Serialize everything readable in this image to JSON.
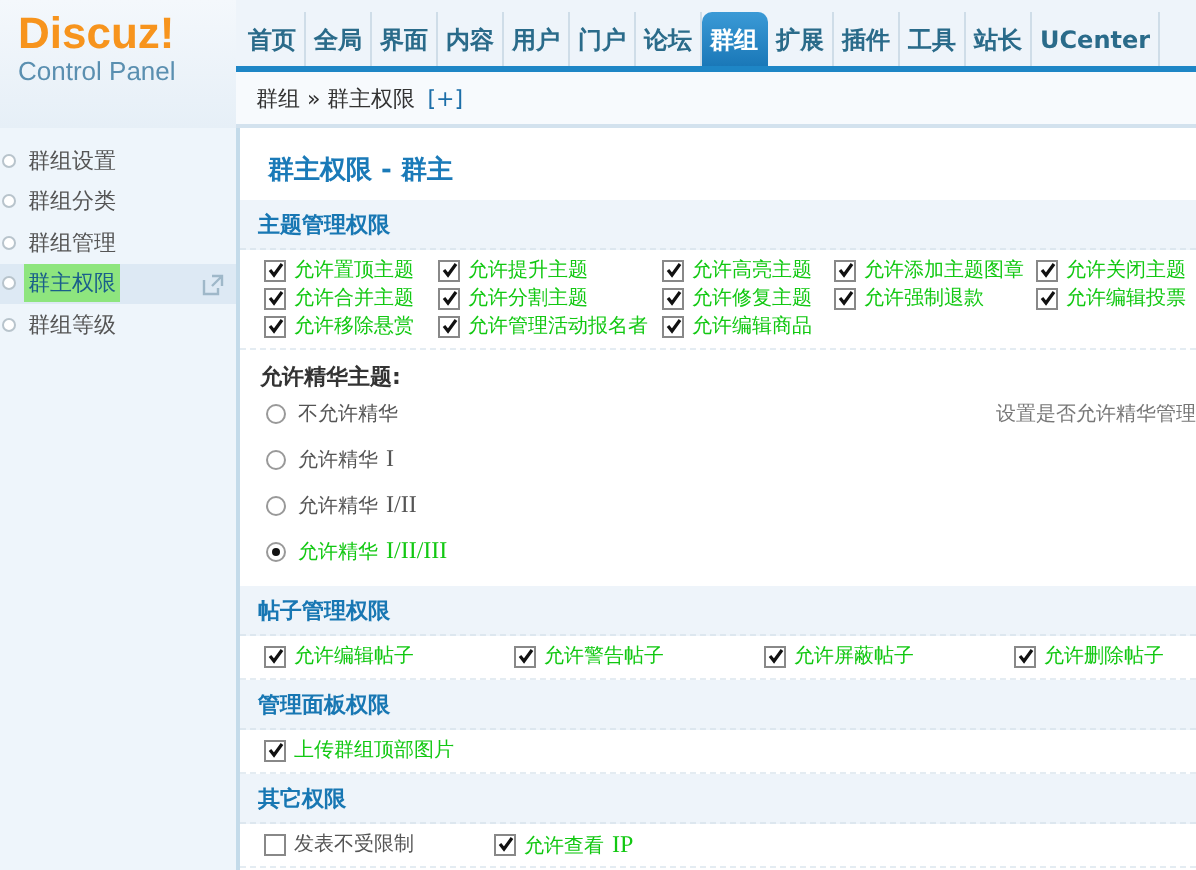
{
  "logo": {
    "brand": "Discuz!",
    "subtitle": "Control Panel"
  },
  "nav": [
    {
      "label": "首页",
      "selected": false
    },
    {
      "label": "全局",
      "selected": false
    },
    {
      "label": "界面",
      "selected": false
    },
    {
      "label": "内容",
      "selected": false
    },
    {
      "label": "用户",
      "selected": false
    },
    {
      "label": "门户",
      "selected": false
    },
    {
      "label": "论坛",
      "selected": false
    },
    {
      "label": "群组",
      "selected": true
    },
    {
      "label": "扩展",
      "selected": false
    },
    {
      "label": "插件",
      "selected": false
    },
    {
      "label": "工具",
      "selected": false
    },
    {
      "label": "站长",
      "selected": false
    },
    {
      "label": "UCenter",
      "selected": false
    }
  ],
  "breadcrumb": {
    "path": "群组 » 群主权限",
    "add_link": "[+]"
  },
  "sidebar": {
    "items": [
      {
        "label": "群组设置",
        "selected": false
      },
      {
        "label": "群组分类",
        "selected": false
      },
      {
        "label": "群组管理",
        "selected": false
      },
      {
        "label": "群主权限",
        "selected": true
      },
      {
        "label": "群组等级",
        "selected": false
      }
    ]
  },
  "page_title": "群主权限 - 群主",
  "sections": [
    {
      "kind": "checkboxes",
      "title": "主题管理权限",
      "options": [
        {
          "label": "允许置顶主题",
          "checked": true
        },
        {
          "label": "允许提升主题",
          "checked": true
        },
        {
          "label": "允许高亮主题",
          "checked": true
        },
        {
          "label": "允许添加主题图章",
          "checked": true
        },
        {
          "label": "允许关闭主题",
          "checked": true
        },
        {
          "label": "允许合并主题",
          "checked": true
        },
        {
          "label": "允许分割主题",
          "checked": true
        },
        {
          "label": "允许修复主题",
          "checked": true
        },
        {
          "label": "允许强制退款",
          "checked": true
        },
        {
          "label": "允许编辑投票",
          "checked": true
        },
        {
          "label": "允许移除悬赏",
          "checked": true
        },
        {
          "label": "允许管理活动报名者",
          "checked": true
        },
        {
          "label": "允许编辑商品",
          "checked": true
        }
      ]
    },
    {
      "kind": "radios",
      "title": "允许精华主题:",
      "note": "设置是否允许精华管理",
      "options": [
        {
          "label": "不允许精华",
          "selected": false
        },
        {
          "label": "允许精华",
          "suffix": "I",
          "selected": false
        },
        {
          "label": "允许精华",
          "suffix": "I/II",
          "selected": false
        },
        {
          "label": "允许精华",
          "suffix": "I/II/III",
          "selected": true
        }
      ]
    },
    {
      "kind": "checkboxes",
      "title": "帖子管理权限",
      "options": [
        {
          "label": "允许编辑帖子",
          "checked": true
        },
        {
          "label": "允许警告帖子",
          "checked": true
        },
        {
          "label": "允许屏蔽帖子",
          "checked": true
        },
        {
          "label": "允许删除帖子",
          "checked": true
        }
      ]
    },
    {
      "kind": "checkboxes",
      "title": "管理面板权限",
      "options": [
        {
          "label": "上传群组顶部图片",
          "checked": true
        }
      ]
    },
    {
      "kind": "checkboxes",
      "title": "其它权限",
      "options": [
        {
          "label": "发表不受限制",
          "checked": false
        },
        {
          "label": "允许查看",
          "suffix": "IP",
          "checked": true
        }
      ]
    }
  ]
}
